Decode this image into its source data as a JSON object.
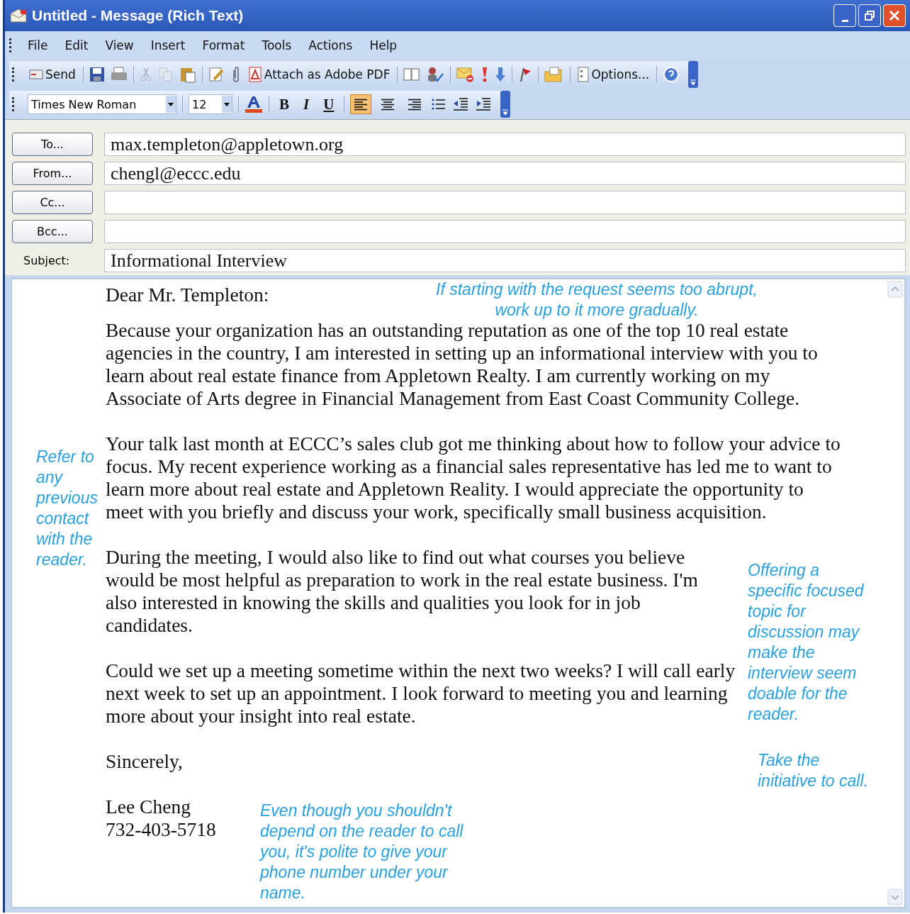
{
  "window": {
    "title": "Untitled - Message (Rich Text)"
  },
  "menu": [
    "File",
    "Edit",
    "View",
    "Insert",
    "Format",
    "Tools",
    "Actions",
    "Help"
  ],
  "standard_toolbar": {
    "send": "Send",
    "attach_pdf": "Attach as Adobe PDF",
    "options": "Options..."
  },
  "format_toolbar": {
    "font": "Times New Roman",
    "size": "12",
    "bold": "B",
    "italic": "I",
    "underline": "U",
    "align_buttons": [
      {
        "selected": true
      },
      {
        "selected": false
      },
      {
        "selected": false
      }
    ]
  },
  "header": {
    "fields": [
      {
        "button": "To...",
        "value": "max.templeton@appletown.org"
      },
      {
        "button": "From...",
        "value": "chengl@eccc.edu"
      },
      {
        "button": "Cc..."
      },
      {
        "button": "Bcc..."
      }
    ],
    "subject_label": "Subject:",
    "subject": "Informational Interview"
  },
  "letter": {
    "greeting": "Dear Mr. Templeton:",
    "paragraphs": [
      "Because your organization has an outstanding reputation as one of the top 10 real estate agencies in the country, I am interested in setting up an informational interview with you to learn about real estate finance from Appletown Realty. I am currently working on my Associate of Arts degree in Financial Management from East Coast Community College.",
      "Your talk last month at ECCC’s sales club got me thinking about how to follow your advice to focus. My recent experience working as a financial sales representative has led me to want to learn more about real estate and Appletown Reality. I would appreciate the opportunity to meet with you briefly and discuss your work, specifically small business acquisition.",
      "During the meeting, I would also like to find out what courses you believe would be most helpful as preparation to work in the real estate business. I'm also interested in knowing the skills and qualities you look for in job candidates.",
      "Could we set up a meeting sometime within the next two weeks? I will call early next week to set up an appointment. I look forward to meeting you and learning more about your insight into real estate."
    ],
    "closing": "Sincerely,",
    "name": "Lee Cheng",
    "phone": "732-403-5718"
  },
  "annotations": [
    {
      "kind": "top",
      "text": "If starting with the request seems too abrupt, work up to it more gradually."
    },
    {
      "kind": "left",
      "text": "Refer to any previous contact with the reader."
    },
    {
      "kind": "right",
      "text": "Offering a specific focused topic for discussion may make the interview seem doable for the reader."
    },
    {
      "kind": "right-lower",
      "text": "Take the initiative to call."
    },
    {
      "kind": "bottom",
      "text": "Even though you shouldn't depend on the reader to call you, it's polite to give your phone number under your name."
    }
  ]
}
